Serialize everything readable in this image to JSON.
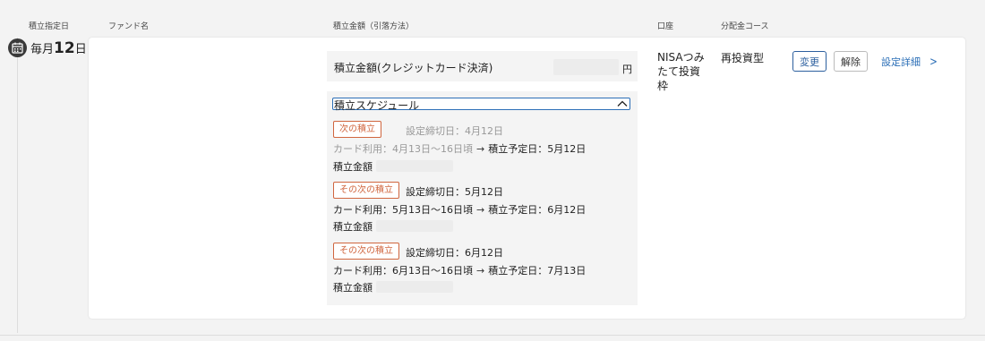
{
  "headers": {
    "date": "積立指定日",
    "fund": "ファンド名",
    "amount": "積立金額（引落方法）",
    "account": "口座",
    "distribution": "分配金コース"
  },
  "row": {
    "day_prefix": "毎月",
    "day_number": "12",
    "day_suffix": "日",
    "amount_label": "積立金額(クレジットカード決済)",
    "amount_unit": "円",
    "schedule_toggle": "積立スケジュール",
    "schedule": [
      {
        "badge": "次の積立",
        "deadline": "設定締切日：4月12日",
        "card_usage": "カード利用：4月13日〜16日頃",
        "planned": "積立予定日：5月12日",
        "amount_label": "積立金額",
        "muted": true
      },
      {
        "badge": "その次の積立",
        "deadline": "設定締切日：5月12日",
        "card_usage": "カード利用：5月13日〜16日頃",
        "planned": "積立予定日：6月12日",
        "amount_label": "積立金額",
        "muted": false
      },
      {
        "badge": "その次の積立",
        "deadline": "設定締切日：6月12日",
        "card_usage": "カード利用：6月13日〜16日頃",
        "planned": "積立予定日：7月13日",
        "amount_label": "積立金額",
        "muted": false
      }
    ],
    "account": "NISAつみたて投資枠",
    "distribution": "再投資型",
    "change_button": "変更",
    "cancel_button": "解除",
    "detail_link": "設定詳細"
  },
  "colors": {
    "accent": "#2c6fb7",
    "badge": "#d0663f"
  },
  "icons": {
    "calendar": "calendar-icon",
    "arrow": "arrow-right-icon",
    "chevron_up": "chevron-up-icon",
    "chevron_right": "chevron-right-icon"
  }
}
